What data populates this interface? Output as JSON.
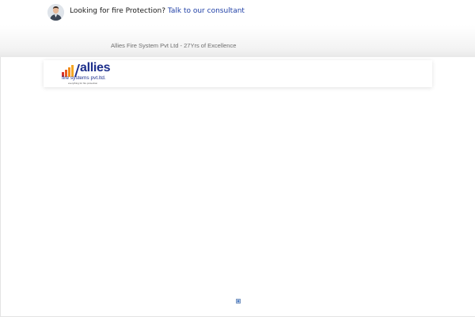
{
  "consultant_bar": {
    "prompt": "Looking for fire Protection?",
    "link_label": "Talk to our consultant"
  },
  "band": {
    "tagline": "Allies Fire System Pvt Ltd - 27Yrs of Excellence"
  },
  "logo": {
    "wordmark": "allies",
    "subtitle": "fire systems pvt.ltd.",
    "tagline": "everything for fire protection"
  },
  "colors": {
    "link": "#1f3fa6",
    "logo_blue": "#1d2f8c",
    "flame_red": "#d9332b",
    "flame_orange": "#f28c1a"
  },
  "icons": {
    "avatar": "consultant-avatar",
    "loader": "loading-icon"
  }
}
